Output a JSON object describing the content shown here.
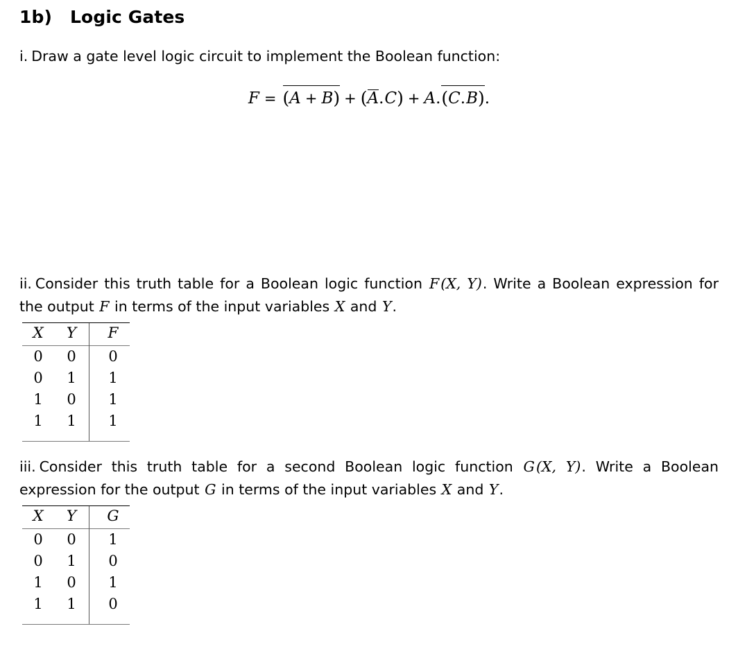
{
  "document": {
    "heading": {
      "number": "1b)",
      "title": "Logic Gates"
    },
    "items": [
      {
        "label": "i.",
        "text": "Draw a gate level logic circuit to implement the Boolean function:"
      },
      {
        "label": "ii.",
        "text_part1": "Consider this truth table for a Boolean logic function ",
        "function_name": "F",
        "function_args": "(X, Y)",
        "text_part2": ". Write a Boolean expression for the output ",
        "output_var": "F",
        "text_part3": " in terms of the input variables ",
        "input_var1": "X",
        "text_and": " and ",
        "input_var2": "Y",
        "text_end": "."
      },
      {
        "label": "iii.",
        "text_part1": "Consider this truth table for a second Boolean logic function ",
        "function_name": "G",
        "function_args": "(X, Y)",
        "text_part2": ". Write a Boolean expression for the output ",
        "output_var": "G",
        "text_part3": " in terms of the input variables ",
        "input_var1": "X",
        "text_and": " and ",
        "input_var2": "Y",
        "text_end": "."
      }
    ],
    "formula": {
      "lhs": "F",
      "equals": "=",
      "term1": {
        "overline": true,
        "open": "(",
        "a": "A",
        "plus": "+",
        "b": "B",
        "close": ")"
      },
      "plus1": "+",
      "term2": {
        "open": "(",
        "a": "A",
        "a_overline": true,
        "dot": ".",
        "c": "C",
        "close": ")"
      },
      "plus2": "+",
      "term3": {
        "a": "A",
        "dot": ".",
        "overline": true,
        "open": "(",
        "c": "C",
        "inner_dot": ".",
        "b": "B",
        "close": ")"
      },
      "period": "."
    },
    "tables": [
      {
        "name": "truth-table-f",
        "headers": [
          "X",
          "Y",
          "F"
        ],
        "rows": [
          [
            "0",
            "0",
            "0"
          ],
          [
            "0",
            "1",
            "1"
          ],
          [
            "1",
            "0",
            "1"
          ],
          [
            "1",
            "1",
            "1"
          ]
        ]
      },
      {
        "name": "truth-table-g",
        "headers": [
          "X",
          "Y",
          "G"
        ],
        "rows": [
          [
            "0",
            "0",
            "1"
          ],
          [
            "0",
            "1",
            "0"
          ],
          [
            "1",
            "0",
            "1"
          ],
          [
            "1",
            "1",
            "0"
          ]
        ]
      }
    ]
  }
}
